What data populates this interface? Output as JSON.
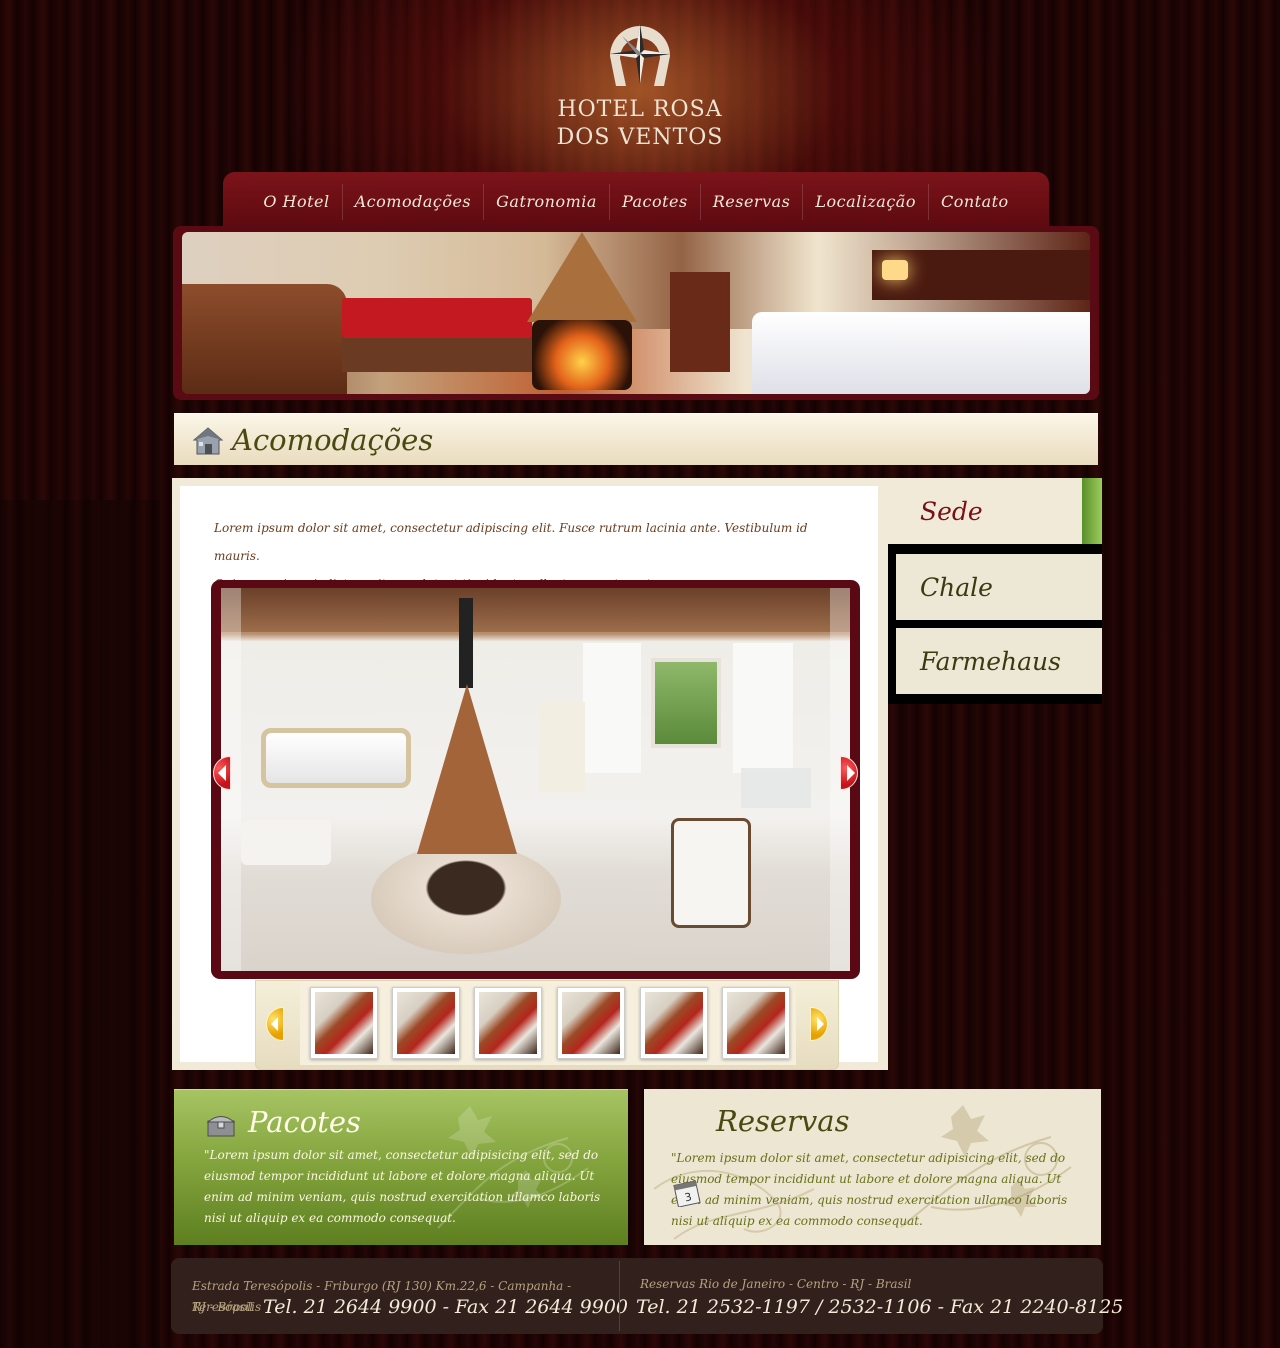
{
  "logo": {
    "line1": "HOTEL ROSA",
    "line2": "DOS VENTOS",
    "icon": "compass-rose-horseshoe-icon"
  },
  "nav": {
    "items": [
      "O Hotel",
      "Acomodações",
      "Gatronomia",
      "Pacotes",
      "Reservas",
      "Localização",
      "Contato"
    ]
  },
  "section": {
    "title": "Acomodações",
    "icon": "house-icon"
  },
  "content": {
    "lorem_line1": "Lorem ipsum dolor sit amet, consectetur adipiscing elit. Fusce rutrum lacinia ante.  Vestibulum id mauris.",
    "lorem_line2": "Quisque enim mi, dictum vitae, volutpat tincidunt,  pellentesque ut, erat.",
    "gallery": {
      "prev_icon": "arrow-left-icon",
      "next_icon": "arrow-right-icon",
      "thumbnail_count": 6
    }
  },
  "sidebar": {
    "tabs": [
      "Sede",
      "Chale",
      "Farmehaus"
    ],
    "active": "Sede"
  },
  "pacotes": {
    "title": "Pacotes",
    "text": "\"Lorem ipsum dolor sit amet, consectetur adipisicing elit, sed do eiusmod tempor incididunt ut labore et dolore magna aliqua. Ut enim ad minim veniam, quis nostrud exercitation ullamco laboris nisi ut aliquip ex ea commodo consequat.",
    "icon": "treasure-chest-icon"
  },
  "reservas": {
    "title": "Reservas",
    "text": "\"Lorem ipsum dolor sit amet, consectetur adipisicing elit, sed do eiusmod tempor incididunt ut labore et dolore magna aliqua. Ut enim ad minim veniam, quis nostrud exercitation ullamco laboris nisi ut aliquip ex ea commodo consequat.",
    "icon": "calendar-icon",
    "calendar_day": "3"
  },
  "footer": {
    "address_line1": "Estrada Teresópolis - Friburgo (RJ 130) Km.22,6 - Campanha - Teresópolis",
    "address_line2": "RJ - Brasil",
    "tel_left": "Tel. 21 2644 9900 - Fax 21 2644 9900",
    "reservas_label": "Reservas Rio de Janeiro - Centro - RJ - Brasil",
    "tel_right": "Tel. 21 2532-1197 / 2532-1106 - Fax 21 2240-8125"
  },
  "colors": {
    "nav_bg": "#6b0f16",
    "accent_red": "#7a1016",
    "accent_green": "#84a53e",
    "cream": "#ede6d2",
    "footer_bg": "#31201c"
  }
}
